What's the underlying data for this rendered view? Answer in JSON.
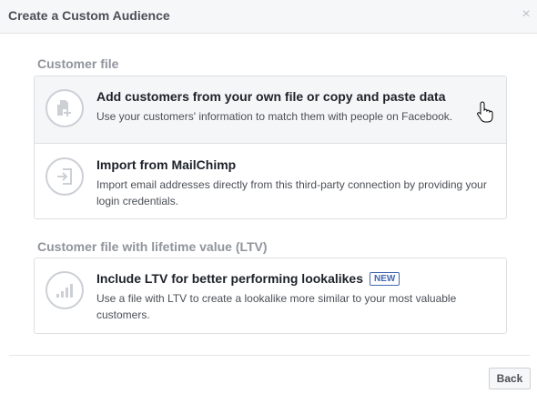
{
  "dialog": {
    "title": "Create a Custom Audience",
    "close_icon": "close-icon"
  },
  "sections": [
    {
      "label": "Customer file",
      "options": [
        {
          "icon": "document-add-icon",
          "title": "Add customers from your own file or copy and paste data",
          "description": "Use your customers' information to match them with people on Facebook."
        },
        {
          "icon": "import-icon",
          "title": "Import from MailChimp",
          "description": "Import email addresses directly from this third-party connection by providing your login credentials."
        }
      ]
    },
    {
      "label": "Customer file with lifetime value (LTV)",
      "options": [
        {
          "icon": "bar-chart-icon",
          "title": "Include LTV for better performing lookalikes",
          "badge": "NEW",
          "description": "Use a file with LTV to create a lookalike more similar to your most valuable customers."
        }
      ]
    }
  ],
  "footer": {
    "back_label": "Back"
  },
  "colors": {
    "header_bg": "#f6f7f9",
    "section_label": "#90949c",
    "badge": "#4267b2",
    "hover_bg": "#f5f6f7"
  }
}
